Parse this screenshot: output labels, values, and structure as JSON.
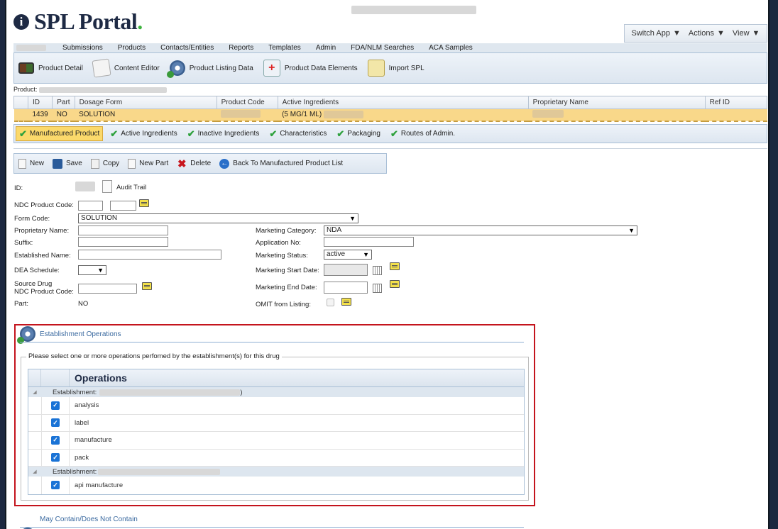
{
  "app": {
    "logo_text": "SPL Portal",
    "logo_dot": ".",
    "logo_icon": "i"
  },
  "header_menu": {
    "switch_app": "Switch App",
    "actions": "Actions",
    "view": "View"
  },
  "menubar": [
    "Submissions",
    "Products",
    "Contacts/Entities",
    "Reports",
    "Templates",
    "Admin",
    "FDA/NLM Searches",
    "ACA Samples"
  ],
  "toolbar": {
    "product_detail": "Product Detail",
    "content_editor": "Content Editor",
    "product_listing_data": "Product Listing Data",
    "product_data_elements": "Product Data Elements",
    "import_spl": "Import SPL"
  },
  "product_label": "Product:",
  "product_table": {
    "headers": [
      "ID",
      "Part",
      "Dosage Form",
      "Product Code",
      "Active Ingredients",
      "Proprietary Name",
      "Ref ID"
    ],
    "row": {
      "id": "1439",
      "part": "NO",
      "dosage_form": "SOLUTION",
      "product_code": "",
      "active_ingredients": "(5 MG/1 ML)",
      "proprietary_name": "",
      "ref_id": ""
    }
  },
  "tabs": [
    "Manufactured Product",
    "Active Ingredients",
    "Inactive Ingredients",
    "Characteristics",
    "Packaging",
    "Routes of Admin."
  ],
  "actions": {
    "new": "New",
    "save": "Save",
    "copy": "Copy",
    "new_part": "New Part",
    "delete": "Delete",
    "back": "Back To Manufactured Product List"
  },
  "form": {
    "id_label": "ID:",
    "audit_trail": "Audit Trail",
    "ndc_label": "NDC Product Code:",
    "form_code_label": "Form Code:",
    "form_code_value": "SOLUTION",
    "proprietary_label": "Proprietary Name:",
    "suffix_label": "Suffix:",
    "established_label": "Established Name:",
    "dea_label": "DEA Schedule:",
    "source_drug_label_1": "Source Drug",
    "source_drug_label_2": "NDC Product Code:",
    "part_label": "Part:",
    "part_value": "NO",
    "marketing_category_label": "Marketing Category:",
    "marketing_category_value": "NDA",
    "application_no_label": "Application No:",
    "marketing_status_label": "Marketing Status:",
    "marketing_status_value": "active",
    "marketing_start_label": "Marketing Start Date:",
    "marketing_end_label": "Marketing End Date:",
    "omit_label": "OMIT from Listing:"
  },
  "establishment": {
    "title": "Establishment Operations",
    "legend": "Please select one or more operations perfomed by the establishment(s) for this drug",
    "column": "Operations",
    "group_label": "Establishment:",
    "group1_suffix": ")",
    "group1_ops": [
      "analysis",
      "label",
      "manufacture",
      "pack"
    ],
    "group2_ops": [
      "api manufacture"
    ]
  },
  "next_section": "May Contain/Does Not Contain"
}
